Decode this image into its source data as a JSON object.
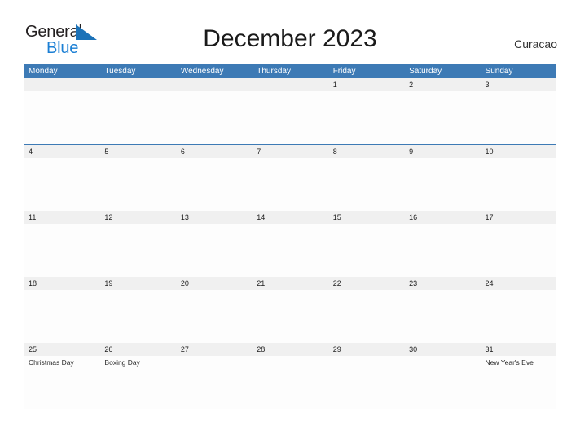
{
  "brand": {
    "name_part1": "General",
    "name_part2": "Blue",
    "flag_icon": "blue-triangle-flag-icon",
    "color_dark": "#231f20",
    "color_blue": "#1b7fd4"
  },
  "header": {
    "title": "December 2023",
    "location": "Curacao"
  },
  "theme": {
    "header_blue": "#3d7ab5",
    "date_strip_gray": "#f0f0f0",
    "cell_white": "#fdfdfd",
    "rule_blue": "#3d7ab5"
  },
  "weekdays": [
    {
      "label": "Monday"
    },
    {
      "label": "Tuesday"
    },
    {
      "label": "Wednesday"
    },
    {
      "label": "Thursday"
    },
    {
      "label": "Friday"
    },
    {
      "label": "Saturday"
    },
    {
      "label": "Sunday"
    }
  ],
  "weeks": [
    {
      "days": [
        {
          "number": "",
          "holiday": ""
        },
        {
          "number": "",
          "holiday": ""
        },
        {
          "number": "",
          "holiday": ""
        },
        {
          "number": "",
          "holiday": ""
        },
        {
          "number": "1",
          "holiday": ""
        },
        {
          "number": "2",
          "holiday": ""
        },
        {
          "number": "3",
          "holiday": ""
        }
      ]
    },
    {
      "days": [
        {
          "number": "4",
          "holiday": ""
        },
        {
          "number": "5",
          "holiday": ""
        },
        {
          "number": "6",
          "holiday": ""
        },
        {
          "number": "7",
          "holiday": ""
        },
        {
          "number": "8",
          "holiday": ""
        },
        {
          "number": "9",
          "holiday": ""
        },
        {
          "number": "10",
          "holiday": ""
        }
      ]
    },
    {
      "days": [
        {
          "number": "11",
          "holiday": ""
        },
        {
          "number": "12",
          "holiday": ""
        },
        {
          "number": "13",
          "holiday": ""
        },
        {
          "number": "14",
          "holiday": ""
        },
        {
          "number": "15",
          "holiday": ""
        },
        {
          "number": "16",
          "holiday": ""
        },
        {
          "number": "17",
          "holiday": ""
        }
      ]
    },
    {
      "days": [
        {
          "number": "18",
          "holiday": ""
        },
        {
          "number": "19",
          "holiday": ""
        },
        {
          "number": "20",
          "holiday": ""
        },
        {
          "number": "21",
          "holiday": ""
        },
        {
          "number": "22",
          "holiday": ""
        },
        {
          "number": "23",
          "holiday": ""
        },
        {
          "number": "24",
          "holiday": ""
        }
      ]
    },
    {
      "days": [
        {
          "number": "25",
          "holiday": "Christmas Day"
        },
        {
          "number": "26",
          "holiday": "Boxing Day"
        },
        {
          "number": "27",
          "holiday": ""
        },
        {
          "number": "28",
          "holiday": ""
        },
        {
          "number": "29",
          "holiday": ""
        },
        {
          "number": "30",
          "holiday": ""
        },
        {
          "number": "31",
          "holiday": "New Year's Eve"
        }
      ]
    }
  ]
}
